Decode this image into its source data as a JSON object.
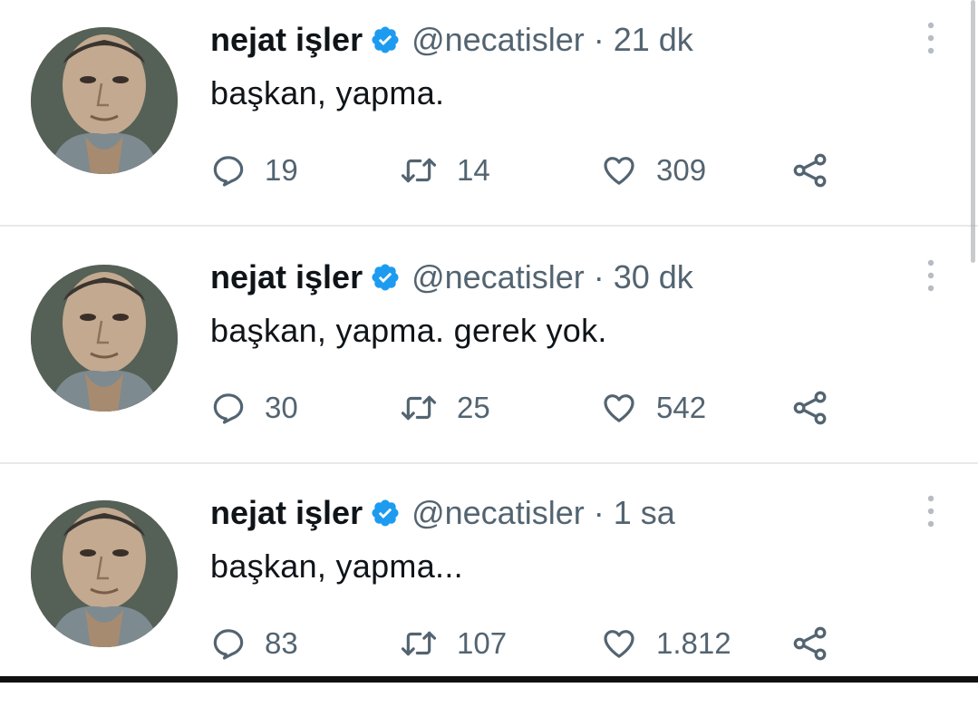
{
  "tweets": [
    {
      "display_name": "nejat işler",
      "handle": "@necatisler",
      "separator": "·",
      "time": "21 dk",
      "text": "başkan, yapma.",
      "replies": "19",
      "retweets": "14",
      "likes": "309"
    },
    {
      "display_name": "nejat işler",
      "handle": "@necatisler",
      "separator": "·",
      "time": "30 dk",
      "text": "başkan, yapma. gerek yok.",
      "replies": "30",
      "retweets": "25",
      "likes": "542"
    },
    {
      "display_name": "nejat işler",
      "handle": "@necatisler",
      "separator": "·",
      "time": "1 sa",
      "text": "başkan, yapma...",
      "replies": "83",
      "retweets": "107",
      "likes": "1.812"
    }
  ],
  "icons": {
    "verified": "verified-badge-icon",
    "reply": "reply-bubble-icon",
    "retweet": "retweet-icon",
    "like": "heart-icon",
    "share": "share-icon",
    "more": "more-vertical-icon"
  },
  "colors": {
    "verified_blue": "#1d9bf0",
    "text_primary": "#0f1419",
    "text_secondary": "#536471",
    "divider": "#e7e9ea"
  }
}
